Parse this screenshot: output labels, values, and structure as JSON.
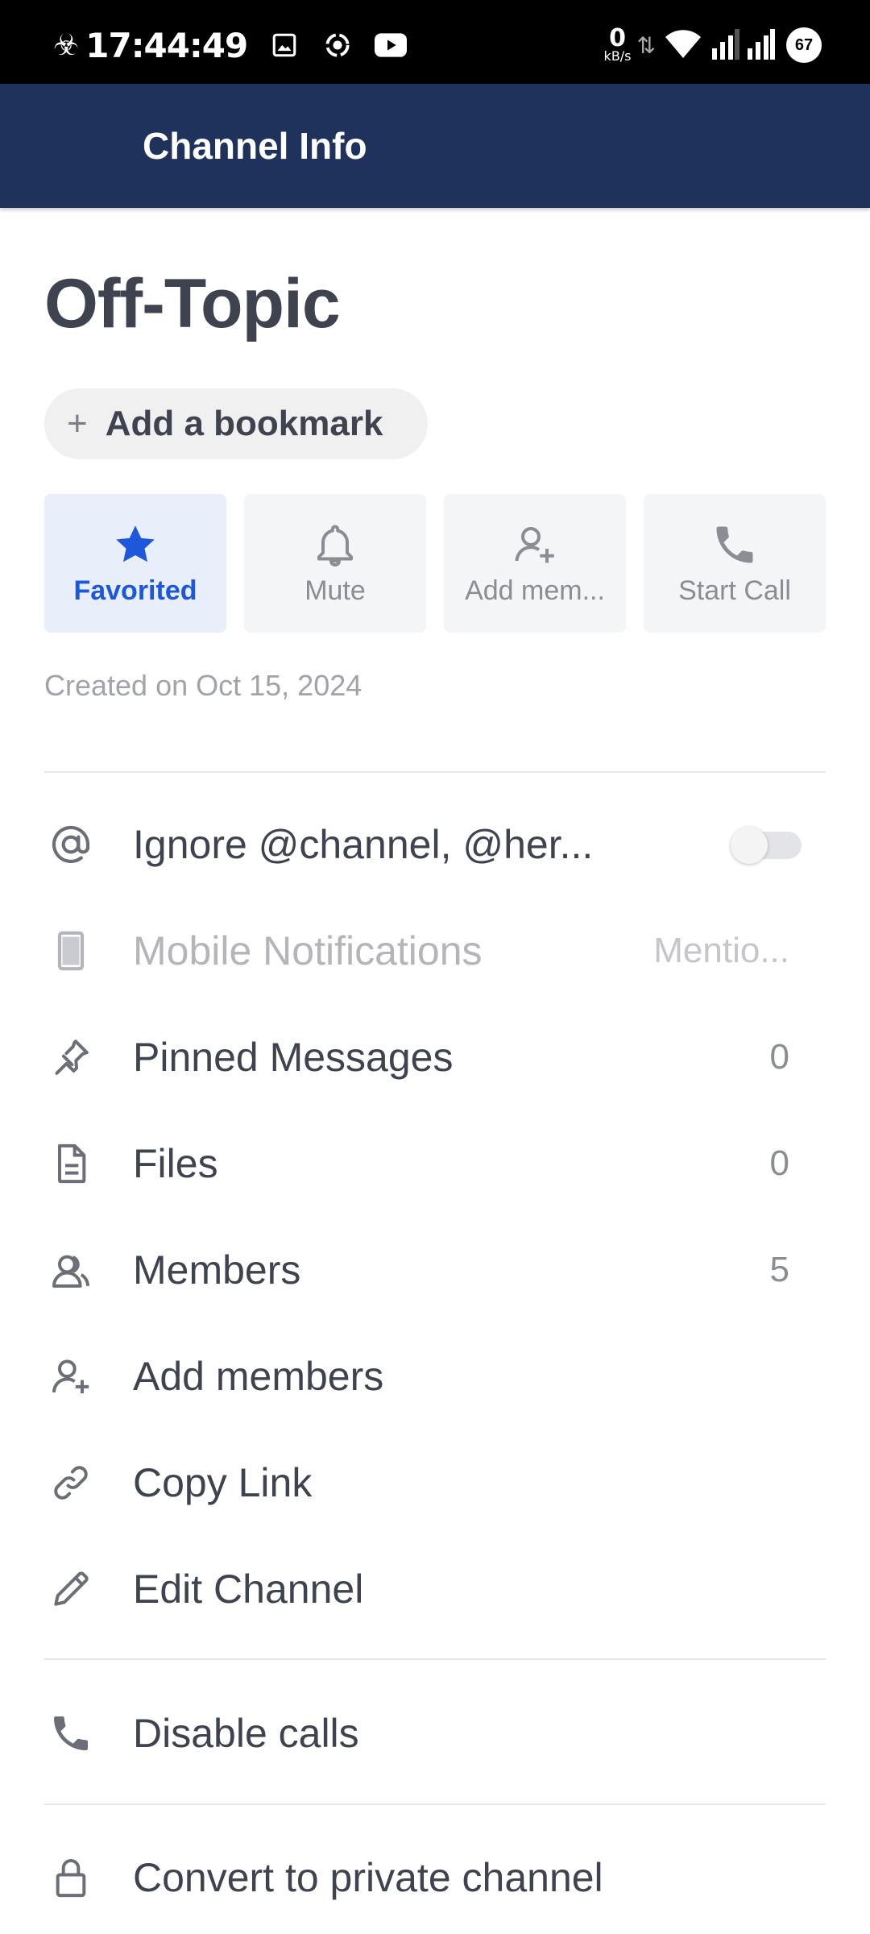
{
  "status_bar": {
    "time": "17:44:49",
    "net_speed_value": "0",
    "net_speed_unit": "kB/s",
    "battery": "67"
  },
  "header": {
    "title": "Channel Info"
  },
  "channel": {
    "name": "Off-Topic",
    "bookmark_plus": "+",
    "bookmark_label": "Add a bookmark",
    "created": "Created on Oct 15, 2024"
  },
  "actions": [
    {
      "label": "Favorited",
      "icon": "star-icon",
      "active": true
    },
    {
      "label": "Mute",
      "icon": "bell-icon",
      "active": false
    },
    {
      "label": "Add mem...",
      "icon": "add-member-icon",
      "active": false
    },
    {
      "label": "Start Call",
      "icon": "phone-icon",
      "active": false
    }
  ],
  "options": {
    "ignore_mentions": {
      "label": "Ignore @channel, @her...",
      "toggle_on": false
    },
    "mobile_notifications": {
      "label": "Mobile Notifications",
      "value": "Mentio..."
    },
    "pinned_messages": {
      "label": "Pinned Messages",
      "value": "0"
    },
    "files": {
      "label": "Files",
      "value": "0"
    },
    "members": {
      "label": "Members",
      "value": "5"
    },
    "add_members": {
      "label": "Add members"
    },
    "copy_link": {
      "label": "Copy Link"
    },
    "edit_channel": {
      "label": "Edit Channel"
    },
    "disable_calls": {
      "label": "Disable calls"
    },
    "convert_private": {
      "label": "Convert to private channel"
    }
  },
  "colors": {
    "header_bg": "#1e325c",
    "accent": "#1c58d9",
    "text": "#3f4350",
    "muted": "#8a8d94"
  }
}
